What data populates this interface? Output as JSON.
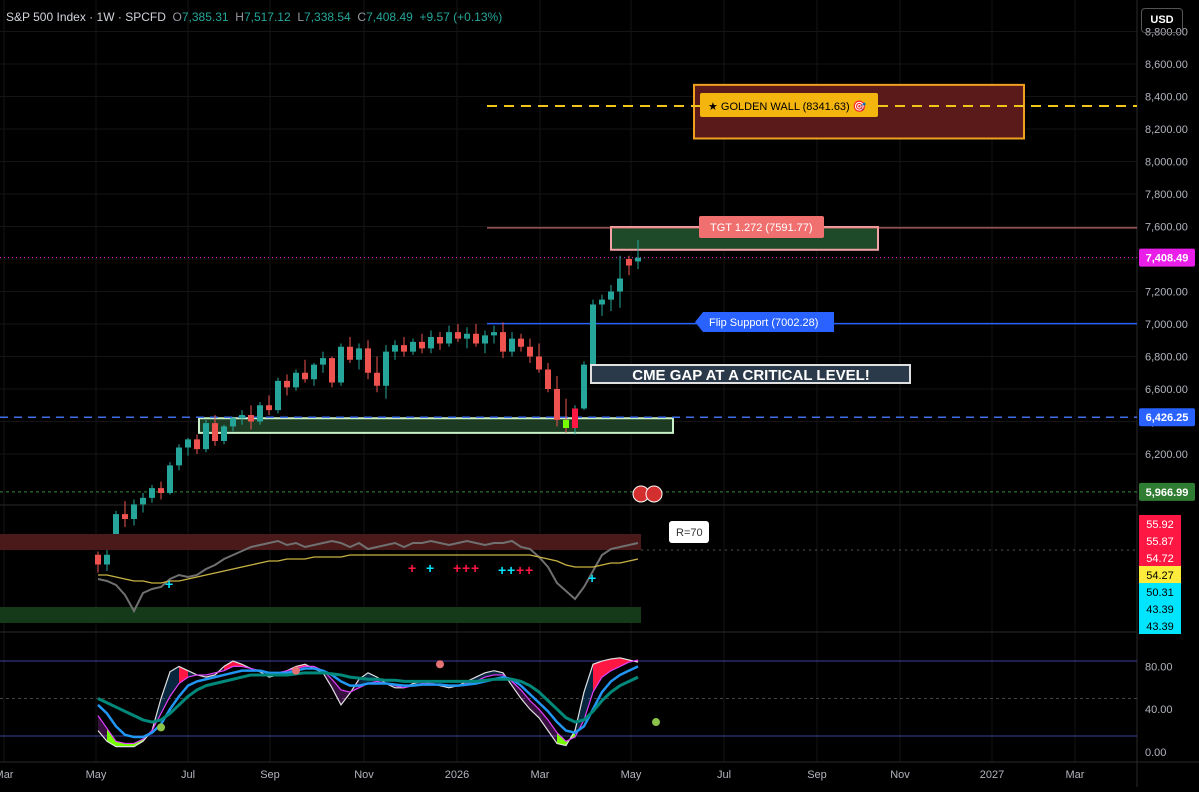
{
  "header": {
    "symbol": "S&P 500 Index",
    "timeframe": "1W",
    "exchange": "SPCFD",
    "open_label": "O",
    "open": "7,385.31",
    "high_label": "H",
    "high": "7,517.12",
    "low_label": "L",
    "low": "7,338.54",
    "close_label": "C",
    "close": "7,408.49",
    "change": "+9.57 (+0.13%)"
  },
  "currency_button": "USD",
  "colors": {
    "up": "#26a69a",
    "down": "#ef5350",
    "bg": "#000000",
    "flip": "#2962ff",
    "gold": "#f0c419",
    "tgt": "#f08080",
    "price_tag": "#e91ee9"
  },
  "chart_data": [
    {
      "type": "candlestick",
      "panel": "price",
      "ylim": [
        5900,
        8800
      ],
      "y_ticks": [
        "6,200.00",
        "6,400.00",
        "6,600.00",
        "6,800.00",
        "7,000.00",
        "7,200.00",
        "7,400.00",
        "7,600.00",
        "7,800.00",
        "8,000.00",
        "8,200.00",
        "8,400.00",
        "8,600.00",
        "8,800.00"
      ],
      "x_ticks": [
        "Mar",
        "May",
        "Jul",
        "Sep",
        "Nov",
        "2026",
        "Mar",
        "May",
        "Jul",
        "Sep",
        "Nov",
        "2027",
        "Mar"
      ],
      "candles": [
        [
          5580,
          5600,
          5470,
          5520
        ],
        [
          5520,
          5610,
          5480,
          5580
        ],
        [
          5700,
          5850,
          5660,
          5830
        ],
        [
          5830,
          5910,
          5750,
          5800
        ],
        [
          5800,
          5920,
          5760,
          5890
        ],
        [
          5890,
          5960,
          5840,
          5930
        ],
        [
          5930,
          6010,
          5900,
          5990
        ],
        [
          5990,
          6030,
          5920,
          5960
        ],
        [
          5960,
          6150,
          5950,
          6130
        ],
        [
          6130,
          6260,
          6100,
          6240
        ],
        [
          6240,
          6300,
          6190,
          6290
        ],
        [
          6290,
          6320,
          6200,
          6230
        ],
        [
          6230,
          6410,
          6210,
          6390
        ],
        [
          6390,
          6440,
          6250,
          6280
        ],
        [
          6280,
          6380,
          6260,
          6370
        ],
        [
          6370,
          6430,
          6340,
          6420
        ],
        [
          6420,
          6470,
          6380,
          6440
        ],
        [
          6440,
          6500,
          6350,
          6400
        ],
        [
          6400,
          6520,
          6380,
          6500
        ],
        [
          6500,
          6560,
          6440,
          6470
        ],
        [
          6470,
          6670,
          6450,
          6650
        ],
        [
          6650,
          6690,
          6560,
          6610
        ],
        [
          6610,
          6720,
          6590,
          6700
        ],
        [
          6700,
          6780,
          6640,
          6660
        ],
        [
          6660,
          6760,
          6620,
          6750
        ],
        [
          6750,
          6830,
          6700,
          6790
        ],
        [
          6790,
          6800,
          6610,
          6640
        ],
        [
          6640,
          6880,
          6620,
          6860
        ],
        [
          6860,
          6920,
          6760,
          6780
        ],
        [
          6780,
          6880,
          6720,
          6850
        ],
        [
          6850,
          6900,
          6660,
          6700
        ],
        [
          6700,
          6800,
          6580,
          6620
        ],
        [
          6620,
          6870,
          6540,
          6830
        ],
        [
          6830,
          6900,
          6780,
          6870
        ],
        [
          6870,
          6920,
          6800,
          6830
        ],
        [
          6830,
          6910,
          6810,
          6890
        ],
        [
          6890,
          6940,
          6820,
          6850
        ],
        [
          6850,
          6960,
          6820,
          6920
        ],
        [
          6920,
          6950,
          6840,
          6880
        ],
        [
          6880,
          6990,
          6860,
          6950
        ],
        [
          6950,
          7000,
          6890,
          6910
        ],
        [
          6910,
          6980,
          6850,
          6940
        ],
        [
          6940,
          7000,
          6860,
          6880
        ],
        [
          6880,
          6960,
          6820,
          6930
        ],
        [
          6930,
          6990,
          6880,
          6950
        ],
        [
          6950,
          7010,
          6790,
          6830
        ],
        [
          6830,
          6950,
          6800,
          6910
        ],
        [
          6910,
          6940,
          6830,
          6860
        ],
        [
          6860,
          6910,
          6760,
          6800
        ],
        [
          6800,
          6880,
          6700,
          6720
        ],
        [
          6720,
          6760,
          6580,
          6600
        ],
        [
          6600,
          6680,
          6370,
          6410
        ],
        [
          6410,
          6540,
          6330,
          6360
        ],
        [
          6360,
          6500,
          6320,
          6480
        ],
        [
          6480,
          6770,
          6470,
          6750
        ],
        [
          6750,
          7150,
          6730,
          7120
        ],
        [
          7120,
          7180,
          7050,
          7150
        ],
        [
          7150,
          7240,
          7080,
          7200
        ],
        [
          7200,
          7420,
          7100,
          7280
        ],
        [
          7400,
          7420,
          7300,
          7360
        ],
        [
          7385,
          7517,
          7338,
          7408
        ]
      ],
      "price_labels": {
        "current": "7,408.49",
        "flip_line": "6,426.25",
        "low_line": "5,966.99",
        "flip_value": 7002.28,
        "tgt_value": 7591.77,
        "golden_value": 8341.63
      },
      "annotations": {
        "golden_wall": "★ GOLDEN WALL (8341.63) 🎯",
        "tgt": "TGT 1.272 (7591.77)",
        "flip_support": "Flip Support (7002.28)",
        "cme_gap": "CME GAP AT A CRITICAL LEVEL!"
      }
    },
    {
      "type": "line",
      "panel": "rsi",
      "label": "R=70",
      "value_tags": [
        "55.92",
        "55.87",
        "54.72",
        "54.27",
        "50.31",
        "43.39",
        "43.39"
      ],
      "series": [
        {
          "color": "#707070",
          "values": [
            48,
            47,
            45,
            40,
            32,
            41,
            43,
            44,
            48,
            50,
            49,
            50,
            53,
            55,
            58,
            60,
            62,
            64,
            65,
            66,
            67,
            65,
            66,
            64,
            65,
            66,
            67,
            66,
            64,
            66,
            63,
            64,
            65,
            66,
            64,
            66,
            66,
            67,
            66,
            65,
            66,
            67,
            66,
            65,
            66,
            66,
            67,
            64,
            63,
            59,
            54,
            46,
            42,
            38,
            44,
            52,
            60,
            63,
            64,
            65,
            66
          ]
        },
        {
          "color": "#c9b343",
          "values": [
            50,
            50,
            49,
            48,
            47,
            47,
            46,
            46,
            47,
            47,
            48,
            49,
            50,
            51,
            52,
            53,
            54,
            55,
            56,
            57,
            57,
            58,
            58,
            58,
            59,
            59,
            59,
            59,
            60,
            60,
            60,
            60,
            60,
            60,
            60,
            60,
            60,
            60,
            60,
            60,
            60,
            60,
            60,
            60,
            60,
            60,
            60,
            60,
            60,
            59,
            58,
            57,
            55,
            54,
            54,
            54,
            55,
            56,
            56,
            57,
            58
          ]
        }
      ]
    },
    {
      "type": "line",
      "panel": "stochastic",
      "y_ticks": [
        "80.00",
        "40.00",
        "0.00"
      ],
      "series": [
        {
          "color": "#e0e0e0",
          "values": [
            20,
            10,
            5,
            5,
            5,
            10,
            20,
            50,
            75,
            80,
            76,
            72,
            70,
            72,
            80,
            85,
            82,
            78,
            75,
            70,
            72,
            76,
            80,
            82,
            78,
            74,
            60,
            44,
            55,
            68,
            74,
            70,
            64,
            60,
            60,
            64,
            66,
            64,
            62,
            60,
            62,
            66,
            70,
            74,
            76,
            74,
            62,
            50,
            40,
            32,
            20,
            8,
            6,
            20,
            56,
            82,
            85,
            87,
            88,
            86,
            84
          ]
        },
        {
          "color": "#e040fb",
          "values": [
            34,
            22,
            10,
            8,
            8,
            12,
            20,
            36,
            52,
            64,
            70,
            72,
            72,
            74,
            76,
            80,
            80,
            78,
            76,
            74,
            74,
            76,
            78,
            80,
            80,
            76,
            68,
            58,
            56,
            60,
            64,
            66,
            64,
            62,
            60,
            62,
            64,
            64,
            63,
            62,
            62,
            64,
            66,
            70,
            72,
            72,
            66,
            58,
            48,
            40,
            30,
            18,
            10,
            14,
            30,
            56,
            70,
            76,
            80,
            84,
            86
          ]
        },
        {
          "color": "#2196f3",
          "values": [
            44,
            36,
            24,
            16,
            14,
            14,
            18,
            26,
            40,
            52,
            62,
            66,
            68,
            70,
            72,
            74,
            76,
            76,
            76,
            74,
            74,
            74,
            76,
            78,
            78,
            76,
            72,
            66,
            62,
            62,
            64,
            64,
            64,
            63,
            62,
            62,
            63,
            63,
            63,
            62,
            62,
            63,
            64,
            66,
            68,
            70,
            68,
            62,
            54,
            46,
            38,
            28,
            20,
            18,
            24,
            40,
            56,
            66,
            72,
            76,
            80
          ]
        },
        {
          "color": "#00897b",
          "values": [
            50,
            46,
            42,
            38,
            34,
            30,
            28,
            30,
            36,
            44,
            52,
            58,
            62,
            64,
            66,
            68,
            70,
            72,
            72,
            72,
            72,
            72,
            73,
            74,
            74,
            74,
            73,
            72,
            70,
            69,
            68,
            68,
            67,
            67,
            66,
            66,
            66,
            66,
            66,
            66,
            66,
            66,
            66,
            67,
            68,
            68,
            68,
            66,
            62,
            56,
            48,
            40,
            32,
            28,
            30,
            38,
            48,
            56,
            62,
            66,
            70
          ]
        }
      ]
    }
  ]
}
